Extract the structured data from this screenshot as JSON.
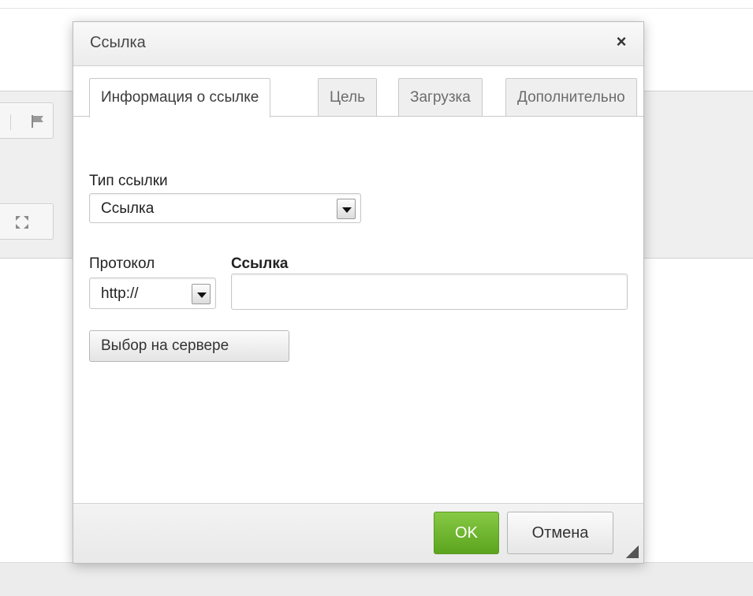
{
  "dialog": {
    "title": "Ссылка",
    "close_glyph": "×",
    "tabs": [
      {
        "label": "Информация о ссылке",
        "active": true
      },
      {
        "label": "Цель",
        "active": false
      },
      {
        "label": "Загрузка",
        "active": false
      },
      {
        "label": "Дополнительно",
        "active": false
      }
    ],
    "link_type": {
      "label": "Тип ссылки",
      "value": "Ссылка"
    },
    "protocol": {
      "label": "Протокол",
      "value": "http://"
    },
    "url": {
      "label": "Ссылка",
      "value": ""
    },
    "browse_server_label": "Выбор на сервере",
    "ok_label": "OK",
    "cancel_label": "Отмена"
  },
  "toolbar": {
    "icons": [
      "flag-icon",
      "maximize-icon"
    ]
  },
  "colors": {
    "ok_button": "#6cb62e",
    "dialog_title_bg": "#f0f0f0",
    "editor_bg": "#efefef"
  }
}
